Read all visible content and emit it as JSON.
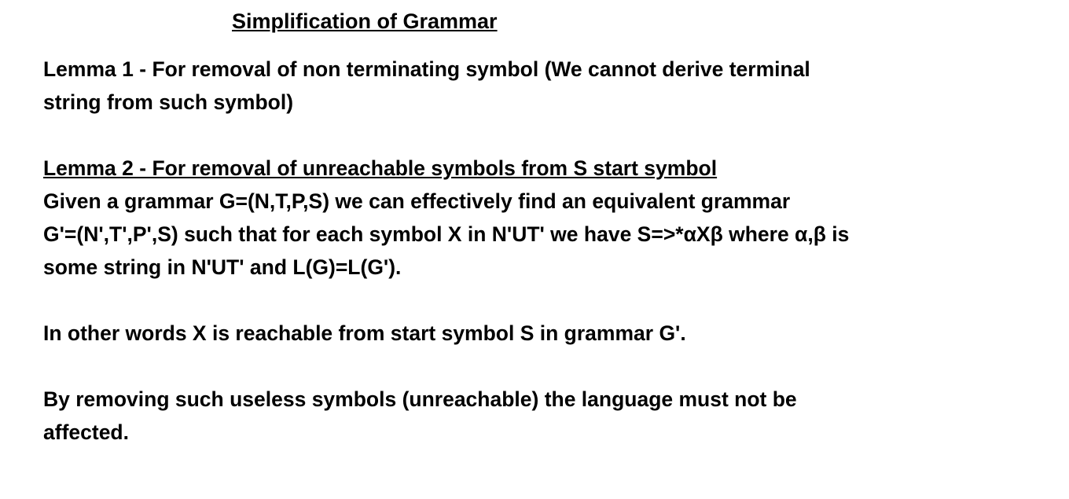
{
  "title": "Simplification of Grammar",
  "lemma1": {
    "line1": "Lemma 1 - For removal of non terminating symbol (We cannot derive terminal",
    "line2": "string from such symbol)"
  },
  "lemma2": {
    "heading": "Lemma 2 - For removal of unreachable symbols from S start symbol",
    "line1": "Given a grammar G=(N,T,P,S) we can effectively find an equivalent grammar",
    "line2": "G'=(N',T',P',S) such that for each symbol X in N'UT' we have S=>*αXβ where α,β is",
    "line3": "some string in N'UT' and L(G)=L(G')."
  },
  "other_words": "In other words X is reachable from start symbol S in grammar G'.",
  "removing": {
    "line1": "By removing such useless symbols (unreachable) the language must not be",
    "line2": "affected."
  }
}
